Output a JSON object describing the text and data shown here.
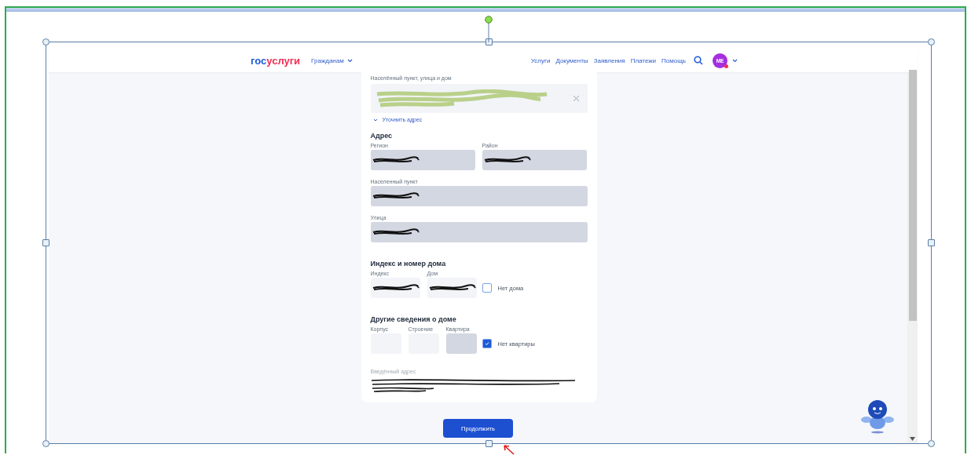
{
  "header": {
    "logo_gos": "гос",
    "logo_uslugi": "услуги",
    "menu": "Гражданам",
    "nav": [
      "Услуги",
      "Документы",
      "Заявления",
      "Платежи",
      "Помощь"
    ],
    "avatar": "МЕ"
  },
  "address_search": {
    "label": "Населённый пункт, улица и дом",
    "link": "Уточнить адрес"
  },
  "sections": [
    {
      "title": "Адрес",
      "rows": [
        [
          {
            "label": "Регион",
            "kind": "half",
            "disabled": true,
            "redacted": true
          },
          {
            "label": "Район",
            "kind": "half",
            "disabled": true,
            "redacted": true
          }
        ],
        [
          {
            "label": "Населенный пункт",
            "kind": "wide",
            "disabled": true,
            "redacted": true
          }
        ],
        [
          {
            "label": "Улица",
            "kind": "wide",
            "disabled": true,
            "redacted": true
          }
        ]
      ]
    },
    {
      "title": "Индекс и номер дома",
      "rows": [
        [
          {
            "label": "Индекс",
            "kind": "short",
            "disabled": false,
            "redacted": true
          },
          {
            "label": "Дом",
            "kind": "short",
            "disabled": false,
            "redacted": true
          }
        ]
      ],
      "checkbox": {
        "label": "Нет дома",
        "checked": false
      }
    },
    {
      "title": "Другие сведения о доме",
      "rows": [
        [
          {
            "label": "Корпус",
            "kind": "narrow",
            "disabled": false
          },
          {
            "label": "Строение",
            "kind": "narrow",
            "disabled": false
          },
          {
            "label": "Квартира",
            "kind": "narrow",
            "disabled": true
          }
        ]
      ],
      "checkbox": {
        "label": "Нет квартиры",
        "checked": true
      }
    }
  ],
  "entered_address": {
    "label": "Введённый адрес"
  },
  "submit": "Продолжить"
}
